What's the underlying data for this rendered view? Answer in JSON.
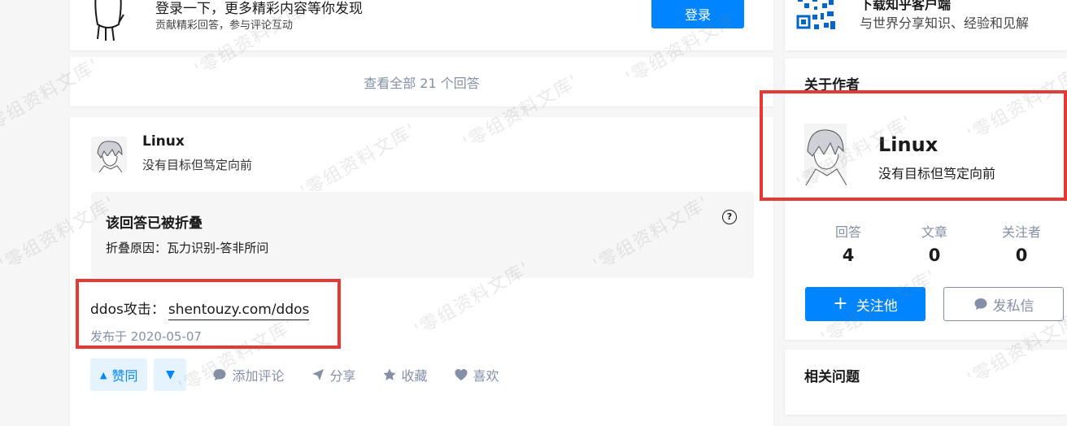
{
  "login": {
    "title": "登录一下，更多精彩内容等你发现",
    "subtitle": "贡献精彩回答，参与评论互动",
    "button": "登录"
  },
  "view_all": "查看全部 21 个回答",
  "answer": {
    "author_name": "Linux",
    "author_bio": "没有目标但笃定向前",
    "collapsed_title": "该回答已被折叠",
    "collapsed_reason": "折叠原因：瓦力识别-答非所问",
    "content_prefix": "ddos攻击：",
    "content_link": "shentouzy.com/ddos",
    "publish_time": "发布于 2020-05-07",
    "actions": {
      "upvote": "赞同",
      "comment": "添加评论",
      "share": "分享",
      "collect": "收藏",
      "like": "喜欢"
    }
  },
  "app": {
    "title": "下载知乎客户端",
    "subtitle": "与世界分享知识、经验和见解"
  },
  "about": {
    "title": "关于作者",
    "name": "Linux",
    "bio": "没有目标但笃定向前",
    "stats": [
      {
        "label": "回答",
        "value": "4"
      },
      {
        "label": "文章",
        "value": "0"
      },
      {
        "label": "关注者",
        "value": "0"
      }
    ],
    "follow_label": "关注他",
    "message_label": "发私信"
  },
  "related": {
    "title": "相关问题"
  },
  "watermark": "'零组资料文库'",
  "colors": {
    "primary": "#0084ff",
    "muted": "#8590a6",
    "highlight_box": "#e53935"
  }
}
